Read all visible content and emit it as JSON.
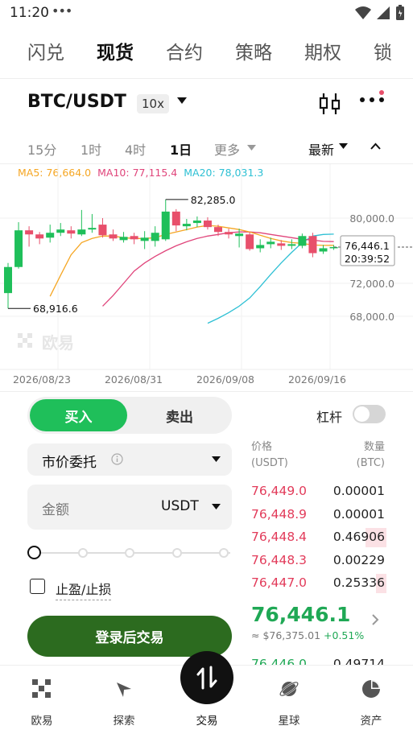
{
  "status_bar": {
    "time": "11:20",
    "dots": "•••"
  },
  "top_tabs": [
    "闪兑",
    "现货",
    "合约",
    "策略",
    "期权",
    "锁"
  ],
  "active_top_tab": "现货",
  "pair": {
    "name": "BTC/USDT",
    "leverage": "10x"
  },
  "intervals": {
    "items": [
      "15分",
      "1时",
      "4时",
      "1日",
      "更多"
    ],
    "active": "1日",
    "latest": "最新"
  },
  "ma_legend": {
    "ma5": "MA5: 76,664.0",
    "ma10": "MA10: 77,115.4",
    "ma20": "MA20: 78,031.3",
    "colors": {
      "ma5": "#f5a623",
      "ma10": "#e0457b",
      "ma20": "#2ec0d4"
    }
  },
  "chart_data": {
    "type": "candlestick",
    "x_labels": [
      "2026/08/23",
      "2026/08/31",
      "2026/09/08",
      "2026/09/16"
    ],
    "y_ticks": [
      "80,000.0",
      "72,000.0",
      "68,000.0"
    ],
    "high_label": "82,285.0",
    "low_label": "68,916.6",
    "current_price": "76,446.1",
    "countdown": "20:39:52",
    "watermark": "欧易",
    "candles": [
      {
        "o": 70800,
        "c": 74000,
        "h": 74500,
        "l": 68916.6
      },
      {
        "o": 74000,
        "c": 78500,
        "h": 79500,
        "l": 73800
      },
      {
        "o": 78500,
        "c": 78000,
        "h": 79000,
        "l": 76500
      },
      {
        "o": 78000,
        "c": 77500,
        "h": 78300,
        "l": 76800
      },
      {
        "o": 77600,
        "c": 78200,
        "h": 79200,
        "l": 77000
      },
      {
        "o": 78200,
        "c": 78600,
        "h": 79400,
        "l": 77800
      },
      {
        "o": 78500,
        "c": 78100,
        "h": 79000,
        "l": 77500
      },
      {
        "o": 78000,
        "c": 78600,
        "h": 81000,
        "l": 77800
      },
      {
        "o": 78600,
        "c": 78800,
        "h": 80500,
        "l": 78200
      },
      {
        "o": 79200,
        "c": 77900,
        "h": 80000,
        "l": 77600
      },
      {
        "o": 78000,
        "c": 77500,
        "h": 78600,
        "l": 77200
      },
      {
        "o": 77300,
        "c": 77700,
        "h": 78300,
        "l": 77000
      },
      {
        "o": 77800,
        "c": 77400,
        "h": 78200,
        "l": 76800
      },
      {
        "o": 77200,
        "c": 77600,
        "h": 78400,
        "l": 76200
      },
      {
        "o": 77200,
        "c": 78200,
        "h": 79000,
        "l": 76500
      },
      {
        "o": 77400,
        "c": 80800,
        "h": 82285,
        "l": 77200
      },
      {
        "o": 80800,
        "c": 79100,
        "h": 81100,
        "l": 78400
      },
      {
        "o": 79000,
        "c": 79300,
        "h": 79900,
        "l": 78500
      },
      {
        "o": 79400,
        "c": 79700,
        "h": 80200,
        "l": 78900
      },
      {
        "o": 79700,
        "c": 78900,
        "h": 80100,
        "l": 78600
      },
      {
        "o": 78900,
        "c": 78300,
        "h": 79200,
        "l": 77800
      },
      {
        "o": 78300,
        "c": 78000,
        "h": 78700,
        "l": 77500
      },
      {
        "o": 77800,
        "c": 78100,
        "h": 78700,
        "l": 76400
      },
      {
        "o": 78000,
        "c": 76200,
        "h": 78300,
        "l": 76000
      },
      {
        "o": 76300,
        "c": 76700,
        "h": 77400,
        "l": 75800
      },
      {
        "o": 76800,
        "c": 77100,
        "h": 77600,
        "l": 76300
      },
      {
        "o": 76900,
        "c": 76600,
        "h": 77300,
        "l": 76100
      },
      {
        "o": 76600,
        "c": 76800,
        "h": 77400,
        "l": 76200
      },
      {
        "o": 76600,
        "c": 77800,
        "h": 78100,
        "l": 76300
      },
      {
        "o": 77800,
        "c": 75700,
        "h": 78200,
        "l": 75200
      },
      {
        "o": 75900,
        "c": 76300,
        "h": 76700,
        "l": 75600
      },
      {
        "o": 76300,
        "c": 76446.1,
        "h": 76700,
        "l": 76100
      }
    ],
    "ma5": [
      null,
      null,
      null,
      null,
      70400,
      73000,
      75500,
      77000,
      77500,
      77800,
      77800,
      77600,
      77500,
      77500,
      77600,
      78000,
      78300,
      78600,
      78900,
      79100,
      79000,
      78800,
      78600,
      78300,
      77900,
      77500,
      77200,
      77000,
      76900,
      76700,
      76650,
      76664
    ],
    "ma10": [
      null,
      null,
      null,
      null,
      null,
      null,
      null,
      null,
      null,
      69200,
      70500,
      72000,
      73500,
      74500,
      75300,
      76000,
      76600,
      77100,
      77500,
      77800,
      78000,
      78200,
      78300,
      78300,
      78200,
      78000,
      77800,
      77600,
      77400,
      77300,
      77150,
      77115.4
    ],
    "ma20": [
      null,
      null,
      null,
      null,
      null,
      null,
      null,
      null,
      null,
      null,
      null,
      null,
      null,
      null,
      null,
      null,
      null,
      null,
      null,
      67100,
      67700,
      68400,
      69200,
      70200,
      71600,
      73100,
      74500,
      75800,
      77000,
      77800,
      78000,
      78031.3
    ],
    "colors": {
      "up": "#1fbf5a",
      "down": "#e84f6b"
    }
  },
  "order": {
    "buy": "买入",
    "sell": "卖出",
    "leverage_label": "杠杆",
    "order_type": "市价委托",
    "amount_label": "金额",
    "amount_unit": "USDT",
    "tpsl_label": "止盈/止损",
    "login_button": "登录后交易",
    "slider_percent": 0
  },
  "orderbook": {
    "price_header": "价格",
    "price_unit": "(USDT)",
    "qty_header": "数量",
    "qty_unit": "(BTC)",
    "asks": [
      {
        "price": "76,449.0",
        "qty": "0.00001",
        "depth": 0.0
      },
      {
        "price": "76,448.9",
        "qty": "0.00001",
        "depth": 0.0
      },
      {
        "price": "76,448.4",
        "qty": "0.46906",
        "depth": 0.14
      },
      {
        "price": "76,448.3",
        "qty": "0.00229",
        "depth": 0.0
      },
      {
        "price": "76,447.0",
        "qty": "0.25336",
        "depth": 0.07
      }
    ],
    "last_price": "76,446.1",
    "last_usd": "≈ $76,375.01",
    "last_change": "+0.51%",
    "partial_bid": {
      "price": "76,446.0",
      "qty": "0.49714"
    }
  },
  "bottom_nav": [
    "欧易",
    "探索",
    "交易",
    "星球",
    "资产"
  ]
}
